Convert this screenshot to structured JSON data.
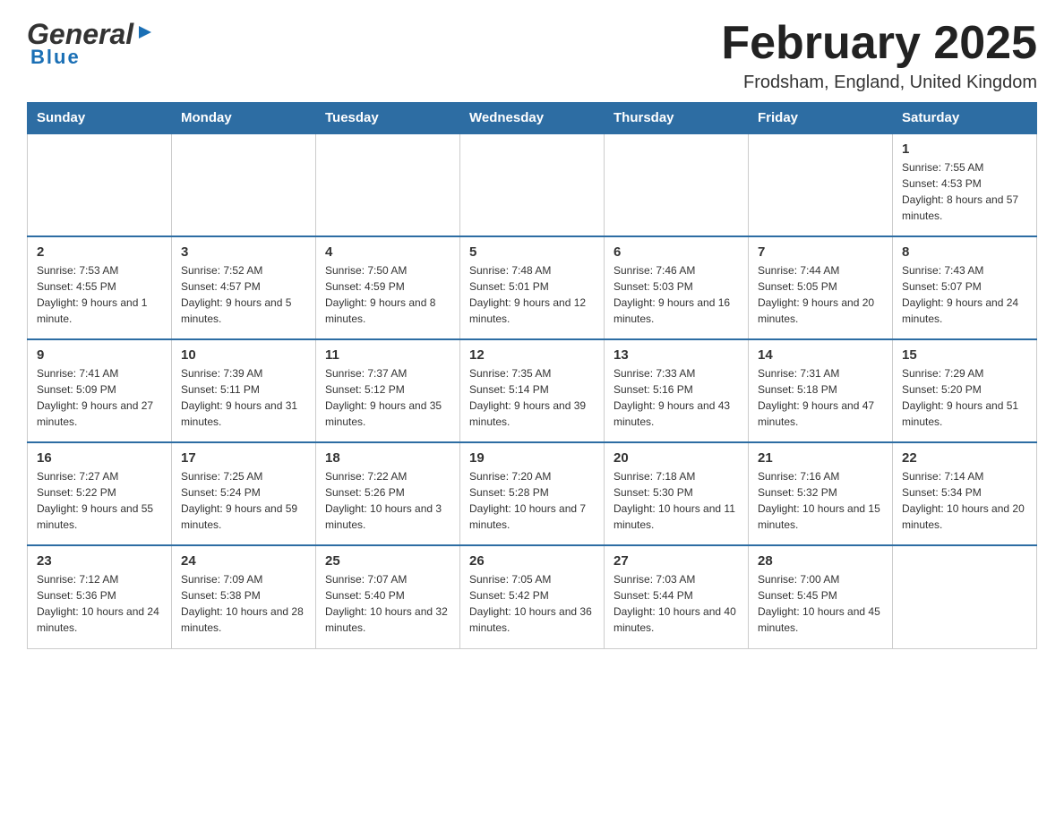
{
  "header": {
    "logo_general": "General",
    "logo_blue": "Blue",
    "title": "February 2025",
    "location": "Frodsham, England, United Kingdom"
  },
  "days_of_week": [
    "Sunday",
    "Monday",
    "Tuesday",
    "Wednesday",
    "Thursday",
    "Friday",
    "Saturday"
  ],
  "weeks": [
    [
      {
        "day": "",
        "info": ""
      },
      {
        "day": "",
        "info": ""
      },
      {
        "day": "",
        "info": ""
      },
      {
        "day": "",
        "info": ""
      },
      {
        "day": "",
        "info": ""
      },
      {
        "day": "",
        "info": ""
      },
      {
        "day": "1",
        "info": "Sunrise: 7:55 AM\nSunset: 4:53 PM\nDaylight: 8 hours and 57 minutes."
      }
    ],
    [
      {
        "day": "2",
        "info": "Sunrise: 7:53 AM\nSunset: 4:55 PM\nDaylight: 9 hours and 1 minute."
      },
      {
        "day": "3",
        "info": "Sunrise: 7:52 AM\nSunset: 4:57 PM\nDaylight: 9 hours and 5 minutes."
      },
      {
        "day": "4",
        "info": "Sunrise: 7:50 AM\nSunset: 4:59 PM\nDaylight: 9 hours and 8 minutes."
      },
      {
        "day": "5",
        "info": "Sunrise: 7:48 AM\nSunset: 5:01 PM\nDaylight: 9 hours and 12 minutes."
      },
      {
        "day": "6",
        "info": "Sunrise: 7:46 AM\nSunset: 5:03 PM\nDaylight: 9 hours and 16 minutes."
      },
      {
        "day": "7",
        "info": "Sunrise: 7:44 AM\nSunset: 5:05 PM\nDaylight: 9 hours and 20 minutes."
      },
      {
        "day": "8",
        "info": "Sunrise: 7:43 AM\nSunset: 5:07 PM\nDaylight: 9 hours and 24 minutes."
      }
    ],
    [
      {
        "day": "9",
        "info": "Sunrise: 7:41 AM\nSunset: 5:09 PM\nDaylight: 9 hours and 27 minutes."
      },
      {
        "day": "10",
        "info": "Sunrise: 7:39 AM\nSunset: 5:11 PM\nDaylight: 9 hours and 31 minutes."
      },
      {
        "day": "11",
        "info": "Sunrise: 7:37 AM\nSunset: 5:12 PM\nDaylight: 9 hours and 35 minutes."
      },
      {
        "day": "12",
        "info": "Sunrise: 7:35 AM\nSunset: 5:14 PM\nDaylight: 9 hours and 39 minutes."
      },
      {
        "day": "13",
        "info": "Sunrise: 7:33 AM\nSunset: 5:16 PM\nDaylight: 9 hours and 43 minutes."
      },
      {
        "day": "14",
        "info": "Sunrise: 7:31 AM\nSunset: 5:18 PM\nDaylight: 9 hours and 47 minutes."
      },
      {
        "day": "15",
        "info": "Sunrise: 7:29 AM\nSunset: 5:20 PM\nDaylight: 9 hours and 51 minutes."
      }
    ],
    [
      {
        "day": "16",
        "info": "Sunrise: 7:27 AM\nSunset: 5:22 PM\nDaylight: 9 hours and 55 minutes."
      },
      {
        "day": "17",
        "info": "Sunrise: 7:25 AM\nSunset: 5:24 PM\nDaylight: 9 hours and 59 minutes."
      },
      {
        "day": "18",
        "info": "Sunrise: 7:22 AM\nSunset: 5:26 PM\nDaylight: 10 hours and 3 minutes."
      },
      {
        "day": "19",
        "info": "Sunrise: 7:20 AM\nSunset: 5:28 PM\nDaylight: 10 hours and 7 minutes."
      },
      {
        "day": "20",
        "info": "Sunrise: 7:18 AM\nSunset: 5:30 PM\nDaylight: 10 hours and 11 minutes."
      },
      {
        "day": "21",
        "info": "Sunrise: 7:16 AM\nSunset: 5:32 PM\nDaylight: 10 hours and 15 minutes."
      },
      {
        "day": "22",
        "info": "Sunrise: 7:14 AM\nSunset: 5:34 PM\nDaylight: 10 hours and 20 minutes."
      }
    ],
    [
      {
        "day": "23",
        "info": "Sunrise: 7:12 AM\nSunset: 5:36 PM\nDaylight: 10 hours and 24 minutes."
      },
      {
        "day": "24",
        "info": "Sunrise: 7:09 AM\nSunset: 5:38 PM\nDaylight: 10 hours and 28 minutes."
      },
      {
        "day": "25",
        "info": "Sunrise: 7:07 AM\nSunset: 5:40 PM\nDaylight: 10 hours and 32 minutes."
      },
      {
        "day": "26",
        "info": "Sunrise: 7:05 AM\nSunset: 5:42 PM\nDaylight: 10 hours and 36 minutes."
      },
      {
        "day": "27",
        "info": "Sunrise: 7:03 AM\nSunset: 5:44 PM\nDaylight: 10 hours and 40 minutes."
      },
      {
        "day": "28",
        "info": "Sunrise: 7:00 AM\nSunset: 5:45 PM\nDaylight: 10 hours and 45 minutes."
      },
      {
        "day": "",
        "info": ""
      }
    ]
  ]
}
